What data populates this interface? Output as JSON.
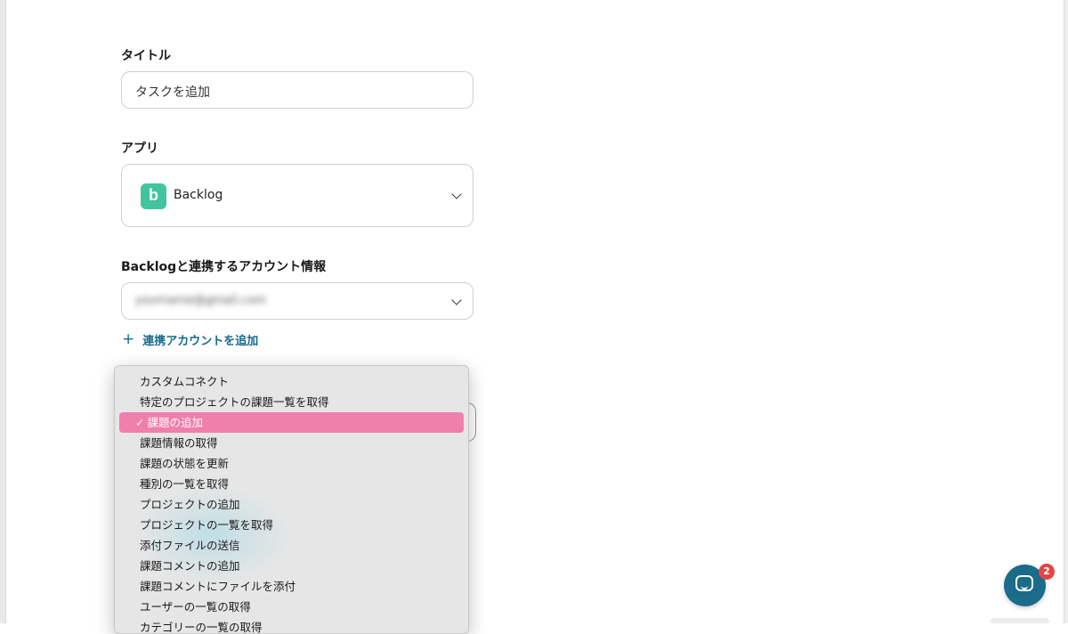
{
  "form": {
    "title_label": "タイトル",
    "title_value": "タスクを追加",
    "app_label": "アプリ",
    "app_name": "Backlog",
    "app_icon": "b",
    "account_label": "Backlogと連携するアカウント情報",
    "account_value": "yourname@gmail.com",
    "add_account_icon": "+",
    "add_account_label": "連携アカウントを追加"
  },
  "dropdown": {
    "items": [
      "カスタムコネクト",
      "特定のプロジェクトの課題一覧を取得",
      "課題の追加",
      "課題情報の取得",
      "課題の状態を更新",
      "種別の一覧を取得",
      "プロジェクトの追加",
      "プロジェクトの一覧を取得",
      "添付ファイルの送信",
      "課題コメントの追加",
      "課題コメントにファイルを添付",
      "ユーザーの一覧の取得",
      "カテゴリーの一覧の取得"
    ],
    "selected_index": 2,
    "check_mark": "✓"
  },
  "chat": {
    "badge_count": "2"
  },
  "colors": {
    "accent": "#186a8d",
    "selected": "#ef7fad",
    "backlog": "#42c4a0",
    "badge": "#e64545"
  }
}
